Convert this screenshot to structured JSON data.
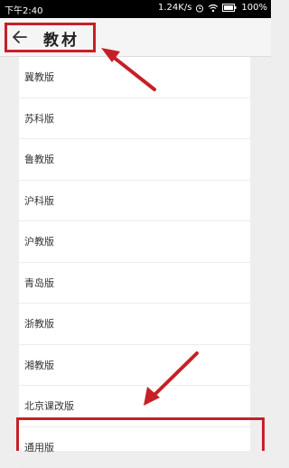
{
  "status_bar": {
    "time": "下午2:40",
    "network_speed": "1.24K/s",
    "battery": "100%",
    "icons": [
      "alarm-icon",
      "wifi-icon",
      "battery-icon"
    ]
  },
  "app_bar": {
    "title": "教材",
    "back_icon": "arrow-left-icon"
  },
  "textbook_list": {
    "items": [
      {
        "label": "冀教版"
      },
      {
        "label": "苏科版"
      },
      {
        "label": "鲁教版"
      },
      {
        "label": "沪科版"
      },
      {
        "label": "沪教版"
      },
      {
        "label": "青岛版"
      },
      {
        "label": "浙教版"
      },
      {
        "label": "湘教版"
      },
      {
        "label": "北京课改版"
      },
      {
        "label": "通用版"
      }
    ]
  },
  "annotations": {
    "highlight_color": "#c62027"
  }
}
